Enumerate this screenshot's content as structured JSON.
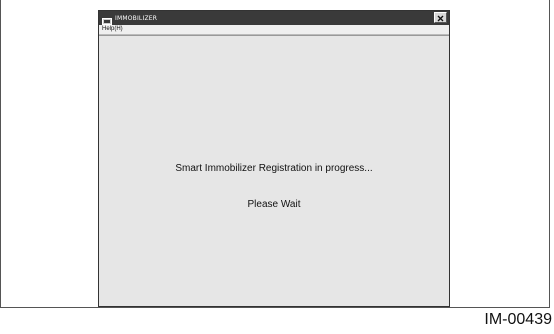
{
  "window": {
    "title": "IMMOBILIZER",
    "menu": {
      "help_label": "Help(H)"
    },
    "message": "Smart Immobilizer Registration in progress...",
    "wait_text": "Please Wait"
  },
  "figure": {
    "caption": "IM-00439"
  },
  "icons": {
    "app": "monitor-icon",
    "close": "close-icon"
  },
  "colors": {
    "titlebar": "#3a3a3a",
    "client_background": "#e6e6e6"
  }
}
